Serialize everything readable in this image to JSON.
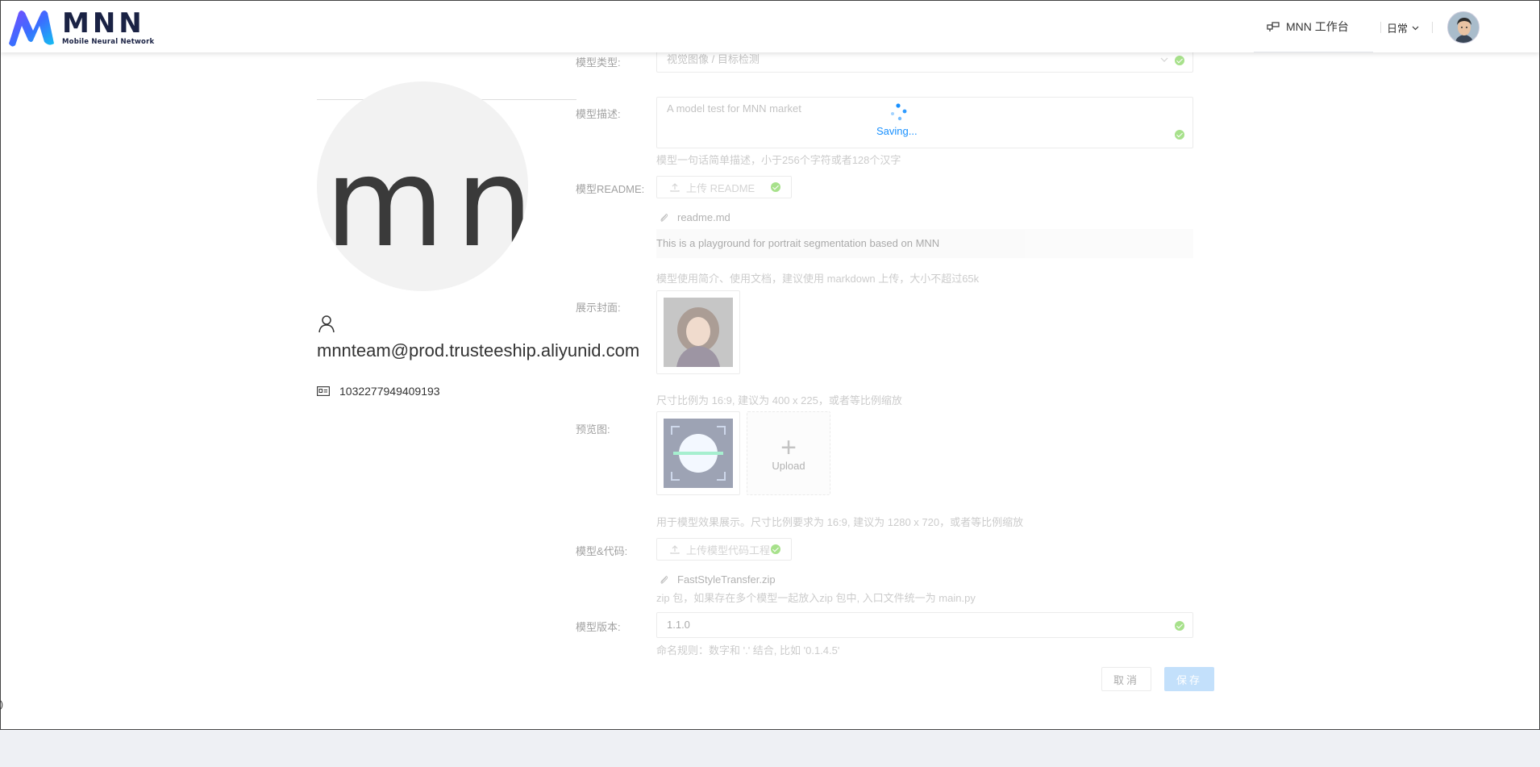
{
  "header": {
    "logo_title": "MNN",
    "logo_subtitle": "Mobile Neural Network",
    "workbench_label": "MNN 工作台",
    "env_label": "日常"
  },
  "profile": {
    "avatar_initials": "mn",
    "email": "mnnteam@prod.trusteeship.aliyunid.com",
    "account_id": "1032277949409193"
  },
  "form": {
    "model_type": {
      "label": "模型类型:",
      "value": "视觉图像 / 目标检测"
    },
    "model_desc": {
      "label": "模型描述:",
      "value": "A model test for MNN market",
      "help": "模型一句话简单描述，小于256个字符或者128个汉字"
    },
    "readme": {
      "label": "模型README:",
      "button": "上传 README",
      "file": "readme.md",
      "preview": "This is a playground for portrait segmentation based on MNN",
      "help": "模型使用简介、使用文档，建议使用 markdown 上传，大小不超过65k"
    },
    "cover": {
      "label": "展示封面:",
      "help": "尺寸比例为 16:9, 建议为 400 x 225，或者等比例缩放"
    },
    "preview": {
      "label": "预览图:",
      "upload_label": "Upload",
      "help": "用于模型效果展示。尺寸比例要求为 16:9, 建议为 1280 x 720，或者等比例缩放"
    },
    "code": {
      "label": "模型&代码:",
      "button": "上传模型代码工程",
      "file": "FastStyleTransfer.zip",
      "help": "zip 包，如果存在多个模型一起放入zip 包中, 入口文件统一为 main.py"
    },
    "version": {
      "label": "模型版本:",
      "value": "1.1.0",
      "help": "命名规则：数字和 '.' 结合, 比如 '0.1.4.5'"
    },
    "cancel_label": "取消",
    "save_label": "保存"
  },
  "overlay": {
    "saving_text": "Saving..."
  },
  "edge_text": ")",
  "colors": {
    "accent": "#1890ff",
    "success": "#52c41a",
    "brand": "#1a2244"
  }
}
